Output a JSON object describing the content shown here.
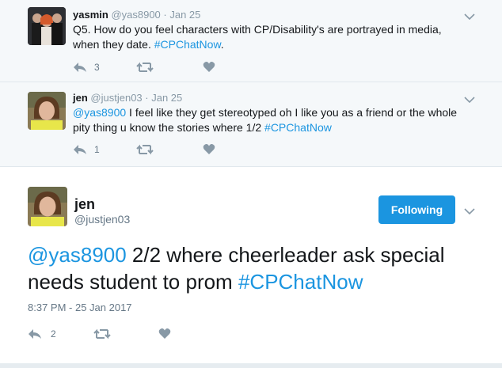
{
  "replies": [
    {
      "name": "yasmin",
      "handle": "@yas8900",
      "date": "· Jan 25",
      "text_plain": "Q5. How do you feel characters with CP/Disability's are portrayed in media, when they date. ",
      "hashtag": "#CPChatNow",
      "text_end": ".",
      "reply_count": "3"
    },
    {
      "name": "jen",
      "handle": "@justjen03",
      "date": "· Jan 25",
      "mention": "@yas8900",
      "text_plain": " I feel like they get stereotyped oh I like you as a friend or the whole pity thing u know the stories where 1/2 ",
      "hashtag": "#CPChatNow",
      "reply_count": "1"
    }
  ],
  "main_tweet": {
    "name": "jen",
    "handle": "@justjen03",
    "follow_label": "Following",
    "mention": "@yas8900",
    "text_plain": " 2/2 where cheerleader ask special needs student to prom ",
    "hashtag": "#CPChatNow",
    "timestamp": "8:37 PM - 25 Jan 2017",
    "reply_count": "2"
  },
  "colors": {
    "link": "#1b95e0",
    "follow_button": "#1b95e0",
    "icon": "#8899a6",
    "conversation_bg": "#f5f8fa"
  },
  "icons": [
    "reply-icon",
    "retweet-icon",
    "like-icon",
    "chevron-down-icon"
  ]
}
